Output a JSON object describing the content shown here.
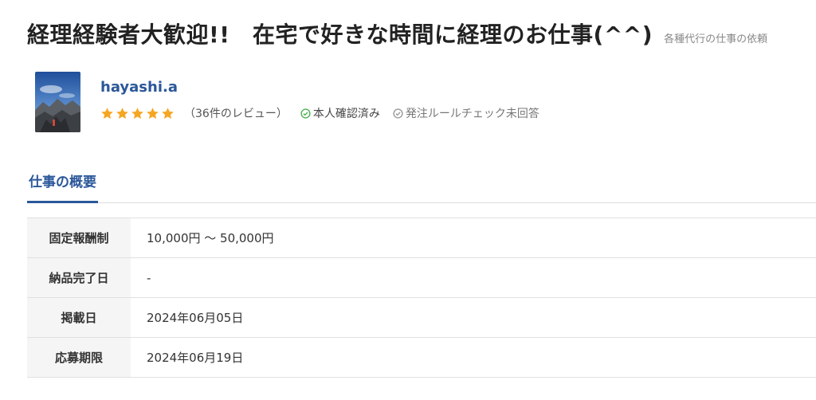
{
  "header": {
    "title": "経理経験者大歓迎!!　在宅で好きな時間に経理のお仕事(^^)",
    "category": "各種代行の仕事の依頼"
  },
  "client": {
    "name": "hayashi.a",
    "rating": 5,
    "max_rating": 5,
    "star_color": "#f5a623",
    "review_count": "（36件のレビュー）",
    "verified_label": "本人確認済み",
    "rule_check_label": "発注ルールチェック未回答"
  },
  "tabs": [
    {
      "label": "仕事の概要",
      "active": true
    }
  ],
  "summary": {
    "rows": [
      {
        "label": "固定報酬制",
        "value": "10,000円 〜 50,000円"
      },
      {
        "label": "納品完了日",
        "value": "-"
      },
      {
        "label": "掲載日",
        "value": "2024年06月05日"
      },
      {
        "label": "応募期限",
        "value": "2024年06月19日"
      }
    ]
  },
  "colors": {
    "accent": "#2b579a",
    "verified": "#4caf50",
    "muted": "#999999"
  }
}
